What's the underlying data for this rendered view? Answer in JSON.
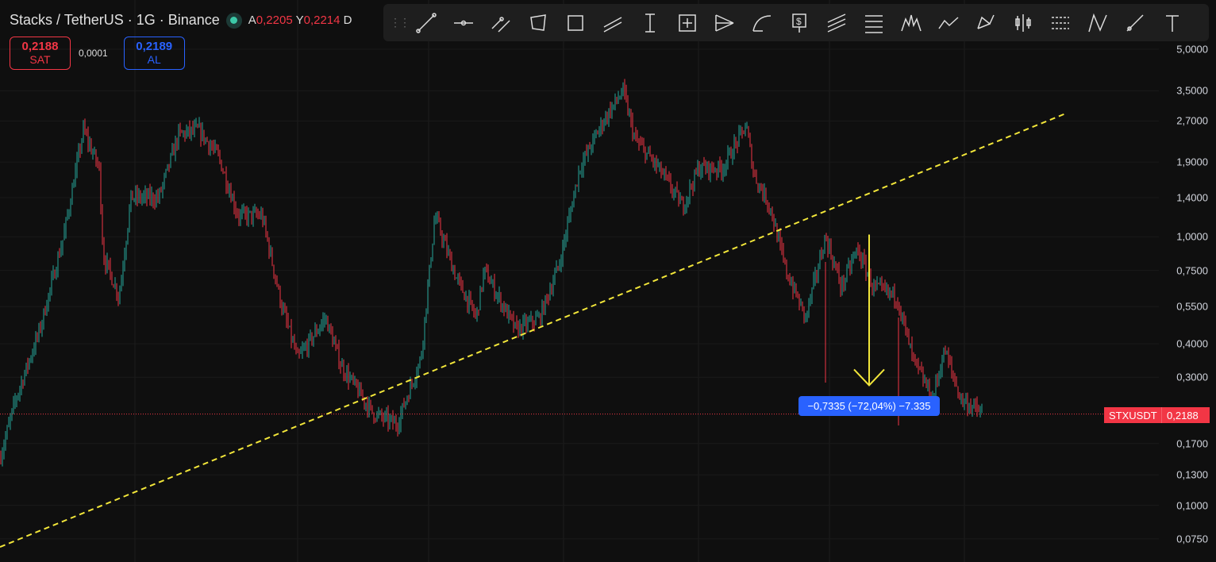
{
  "header": {
    "title": "Stacks / TetherUS · 1G · Binance",
    "open_label": "A",
    "open_value": "0,2205",
    "high_label": "Y",
    "high_value": "0,2214",
    "low_label": "D"
  },
  "trade": {
    "sell_price": "0,2188",
    "sell_label": "SAT",
    "spread": "0,0001",
    "buy_price": "0,2189",
    "buy_label": "AL"
  },
  "toolbar": {
    "tools": [
      "trend-line",
      "horizontal-ray",
      "parallel-channel",
      "rectangle-rotated",
      "rectangle",
      "flat-channel",
      "price-range",
      "date-price-range",
      "pitchfork",
      "arc",
      "price-label",
      "fib-channel",
      "fib-retracement",
      "head-shoulders",
      "path",
      "pattern-xabcd",
      "candles-bars",
      "long-position",
      "triangle-pattern",
      "ray",
      "text"
    ]
  },
  "price_axis": {
    "labels": [
      "5,0000",
      "3,5000",
      "2,7000",
      "1,9000",
      "1,4000",
      "1,0000",
      "0,7500",
      "0,5500",
      "0,4000",
      "0,3000",
      "0,1700",
      "0,1300",
      "0,1000",
      "0,0750"
    ],
    "values": [
      5,
      3.5,
      2.7,
      1.9,
      1.4,
      1.0,
      0.75,
      0.55,
      0.4,
      0.3,
      0.17,
      0.13,
      0.1,
      0.075
    ]
  },
  "symbol_tag": "STXUSDT",
  "last_price": "0,2188",
  "last_price_value": 0.2188,
  "measure": {
    "label": "−0,7335 (−72,04%) −7.335",
    "from": 1.02,
    "to": 0.28
  },
  "colors": {
    "up": "#26a69a",
    "down": "#f23645",
    "trend": "#f2e63a",
    "measure": "#2962ff"
  },
  "chart_data": {
    "type": "candlestick",
    "scale": "log",
    "ylim": [
      0.07,
      5.5
    ],
    "price_path": [
      0.15,
      0.25,
      0.45,
      1.0,
      2.5,
      1.8,
      0.85,
      0.6,
      1.4,
      1.4,
      2.4,
      2.5,
      2.0,
      1.2,
      1.2,
      0.55,
      0.35,
      0.5,
      0.33,
      0.22,
      0.2,
      0.35,
      1.2,
      0.7,
      0.5,
      0.75,
      0.45,
      0.5,
      0.8,
      1.8,
      2.7,
      3.5,
      2.3,
      1.8,
      1.3,
      1.8,
      1.8,
      2.6,
      1.7,
      1.3,
      0.75,
      0.5,
      1.0,
      0.65,
      0.9,
      0.65,
      0.6,
      0.35,
      0.25,
      0.38,
      0.25,
      0.2188
    ],
    "trendline": {
      "from": 0.07,
      "to": 2.9
    }
  }
}
